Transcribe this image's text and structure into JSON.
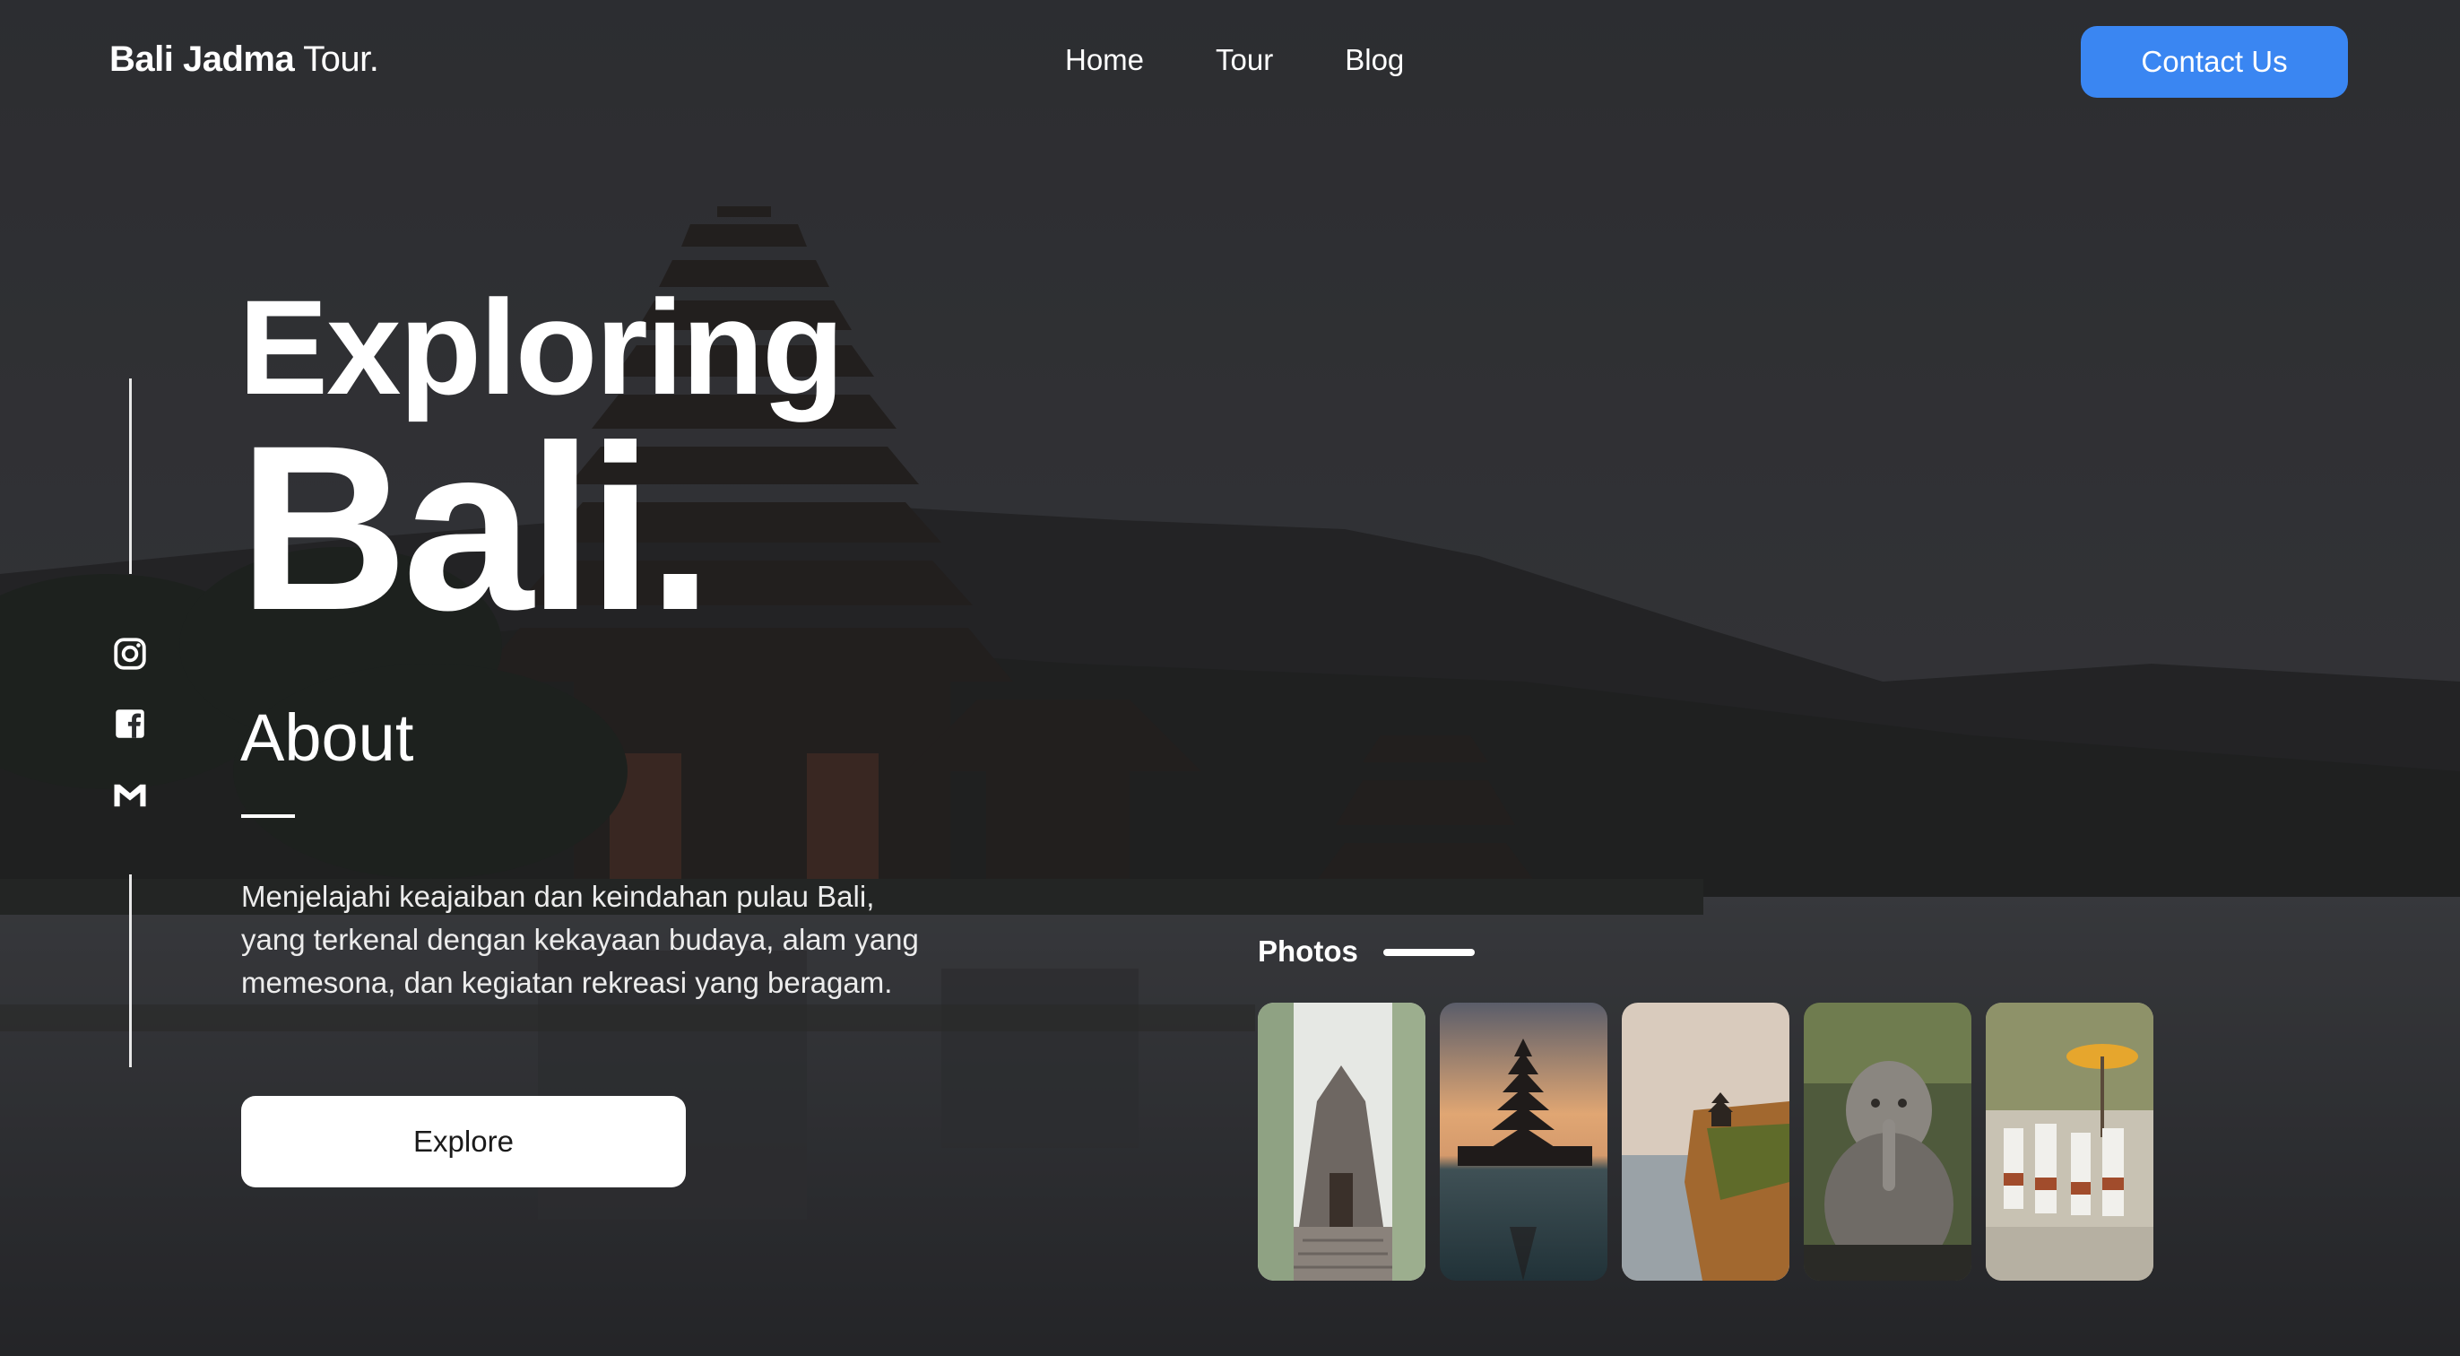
{
  "brand": {
    "bold": "Bali Jadma",
    "regular": " Tour."
  },
  "nav": {
    "items": [
      "Home",
      "Tour",
      "Blog"
    ]
  },
  "header": {
    "contact_label": "Contact Us"
  },
  "hero": {
    "line1": "Exploring",
    "line2": "Bali.",
    "about_heading": "About",
    "about_text": "Menjelajahi keajaiban dan keindahan pulau Bali, yang terkenal dengan kekayaan budaya, alam yang memesona, dan kegiatan rekreasi yang beragam.",
    "explore_label": "Explore"
  },
  "social": {
    "icons": [
      "instagram-icon",
      "facebook-icon",
      "gmail-icon"
    ]
  },
  "photos": {
    "label": "Photos",
    "items": [
      "temple-gate-photo",
      "water-temple-sunset-photo",
      "cliff-temple-photo",
      "ganesha-statue-photo",
      "ceremony-procession-photo"
    ]
  },
  "colors": {
    "accent": "#3a86f2",
    "overlay": "#2a2b2e",
    "text": "#ffffff"
  }
}
